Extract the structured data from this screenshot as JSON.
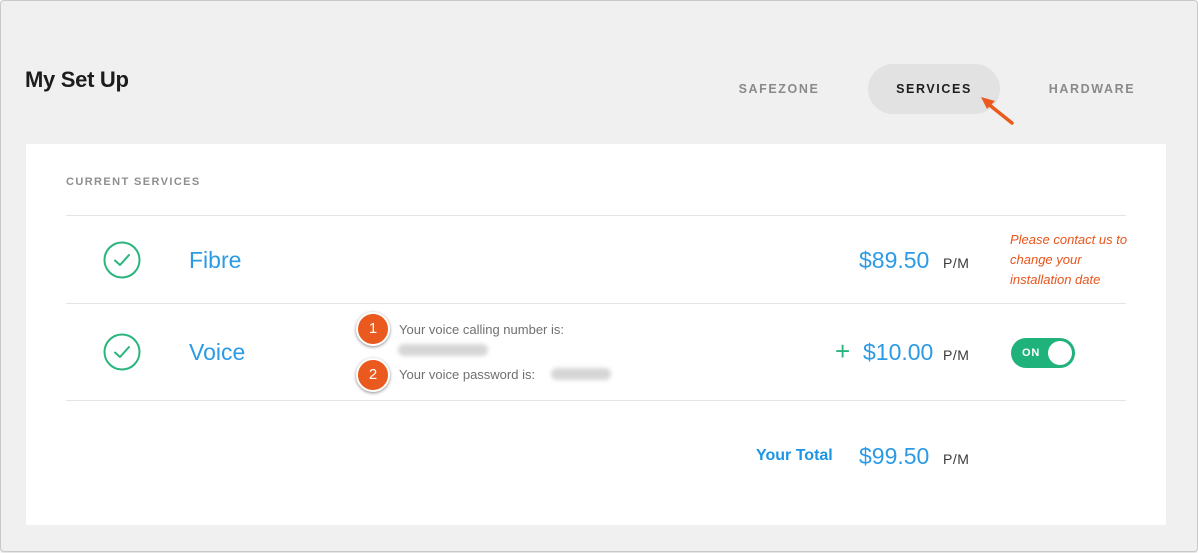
{
  "page": {
    "title": "My Set Up"
  },
  "tabs": [
    {
      "label": "SAFEZONE",
      "active": false
    },
    {
      "label": "SERVICES",
      "active": true
    },
    {
      "label": "HARDWARE",
      "active": false
    }
  ],
  "current_services": {
    "heading": "CURRENT SERVICES",
    "services": [
      {
        "name": "Fibre",
        "price": "$89.50",
        "period": "P/M",
        "icon": "check-circle-icon",
        "note": "Please contact us to change your installation date"
      },
      {
        "name": "Voice",
        "price_prefix": "+",
        "price": "$10.00",
        "period": "P/M",
        "icon": "check-circle-icon",
        "calling_number_label": "Your voice calling number is:",
        "password_label": "Your voice password is:",
        "toggle_label": "ON"
      }
    ]
  },
  "annotations": {
    "badge_1": "1",
    "badge_2": "2",
    "color": "#ea5a1f"
  },
  "total": {
    "label": "Your Total",
    "price": "$99.50",
    "period": "P/M"
  },
  "colors": {
    "accent_blue": "#2c9be6",
    "check_green": "#2ab57d",
    "toggle_green": "#1fb27a",
    "note_orange": "#e8541c"
  }
}
